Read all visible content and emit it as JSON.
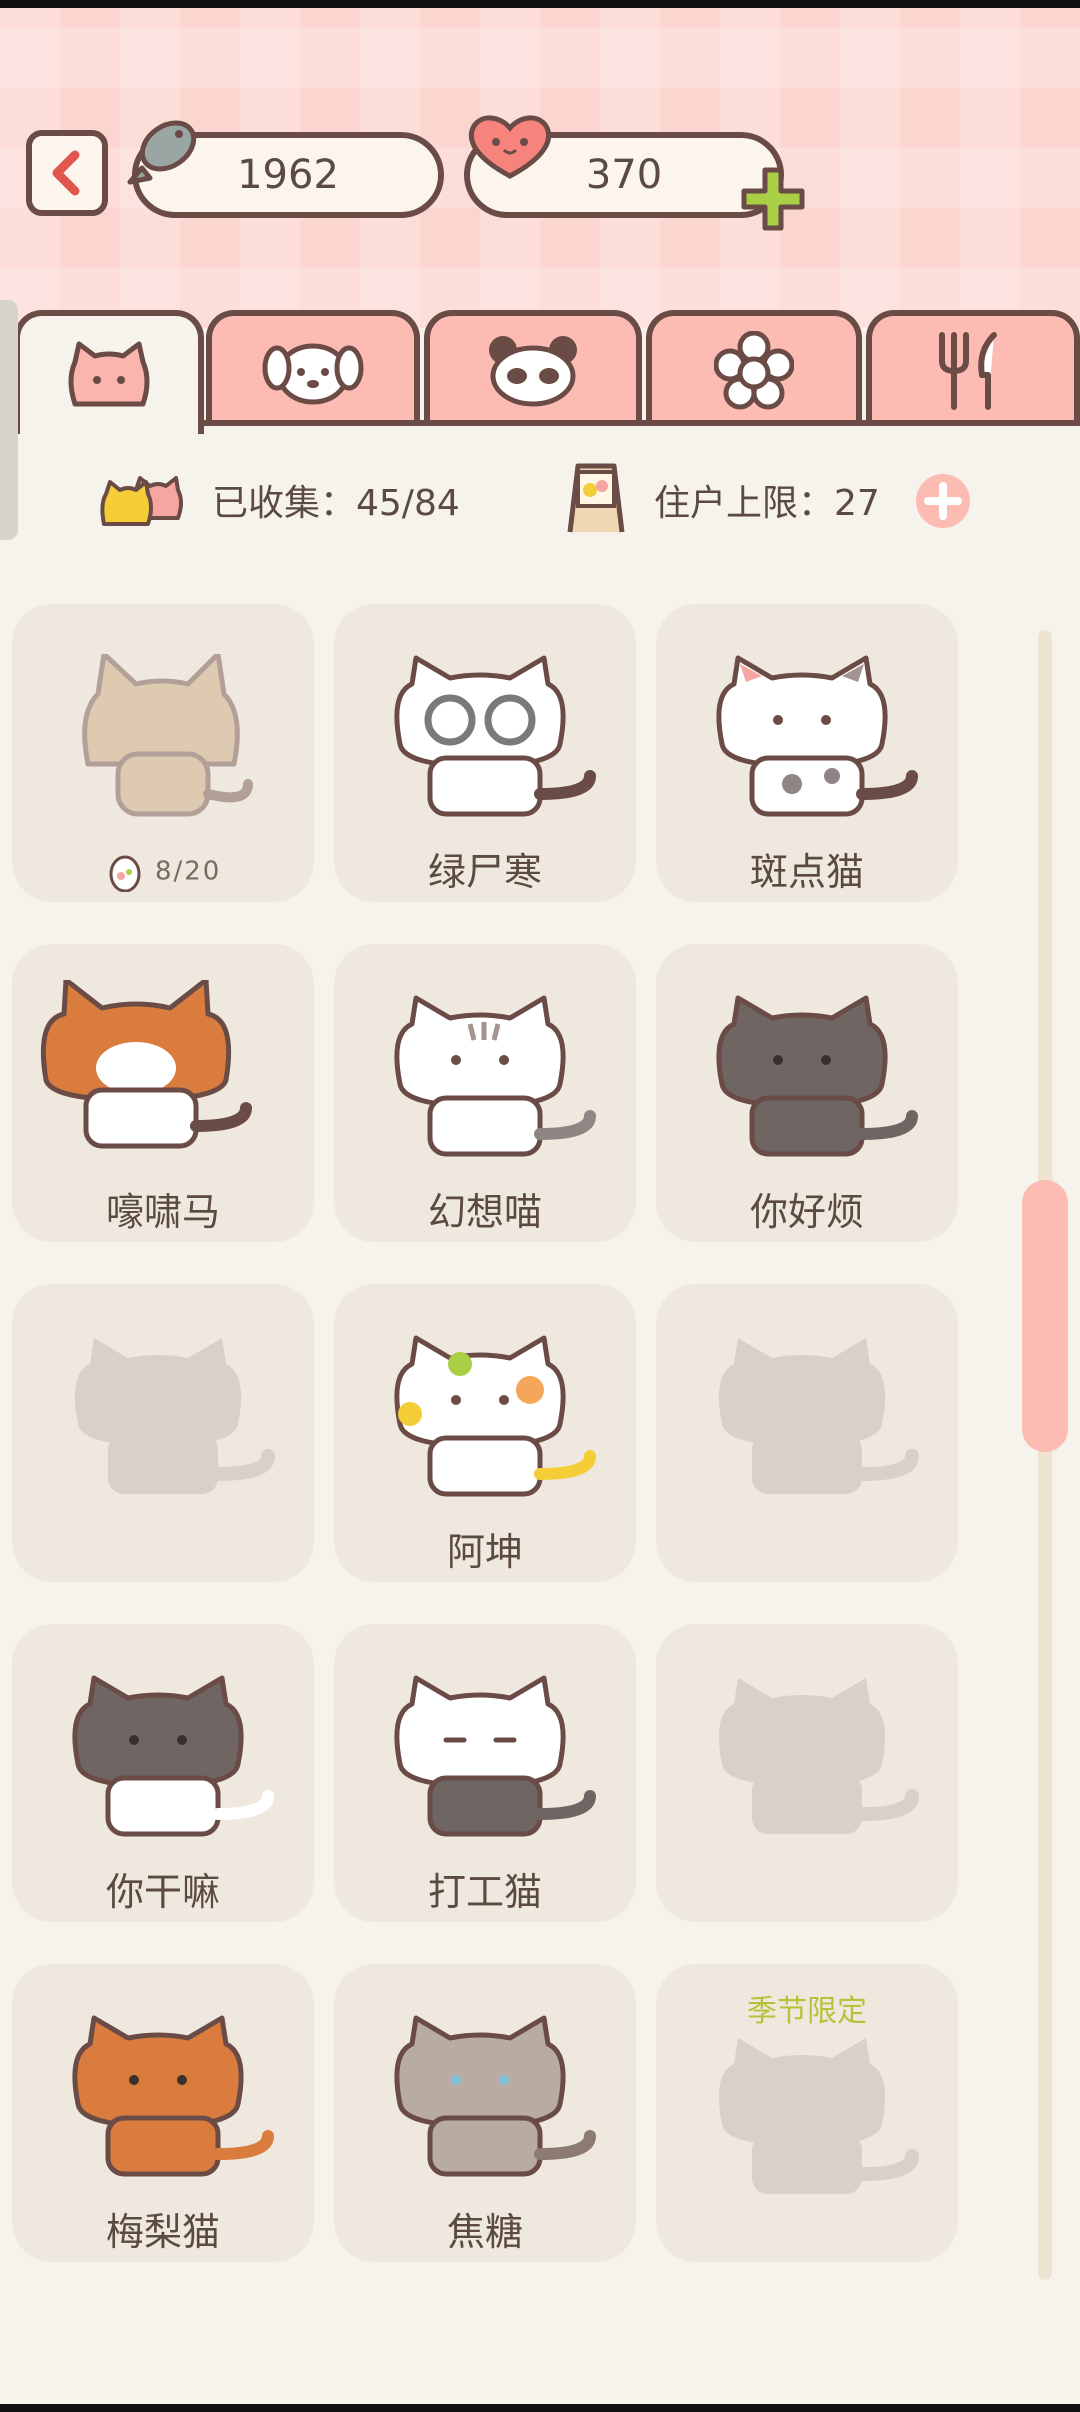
{
  "header": {
    "fish_count": "1962",
    "heart_count": "370"
  },
  "tabs": [
    {
      "id": "cats",
      "icon": "cat-face-icon"
    },
    {
      "id": "dogs",
      "icon": "dog-face-icon"
    },
    {
      "id": "pandas",
      "icon": "panda-face-icon"
    },
    {
      "id": "flowers",
      "icon": "flower-icon"
    },
    {
      "id": "food",
      "icon": "cutlery-icon"
    }
  ],
  "stats": {
    "collected": "已收集：45/84",
    "resident_limit": "住户上限：27"
  },
  "cards": [
    {
      "name": "",
      "progress": "8/20",
      "state": "partial"
    },
    {
      "name": "绿尸寒"
    },
    {
      "name": "斑点猫"
    },
    {
      "name": "嚎啸马"
    },
    {
      "name": "幻想喵"
    },
    {
      "name": "你好烦"
    },
    {
      "name": "",
      "state": "locked"
    },
    {
      "name": "阿坤"
    },
    {
      "name": "",
      "state": "locked"
    },
    {
      "name": "你干嘛"
    },
    {
      "name": "打工猫"
    },
    {
      "name": "",
      "state": "locked"
    },
    {
      "name": "梅梨猫"
    },
    {
      "name": "焦糖"
    },
    {
      "name": "",
      "state": "locked",
      "badge": "季节限定"
    }
  ],
  "colors": {
    "accent_pink": "#fdbcb3",
    "outline": "#6a4b45",
    "card_bg": "#efe8de",
    "season_green": "#b5c33a"
  },
  "scroll_position": 0.42
}
